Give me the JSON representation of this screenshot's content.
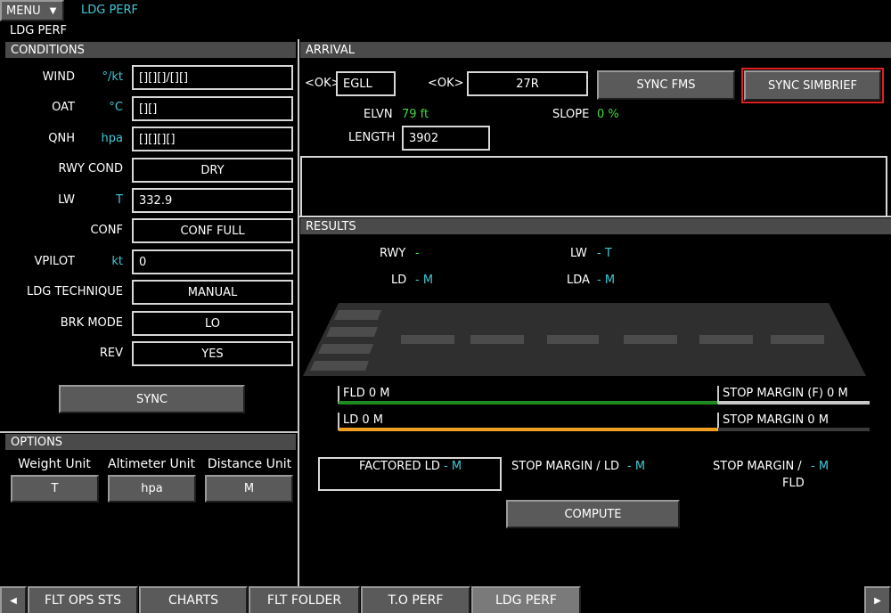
{
  "topbar": {
    "menu": "MENU",
    "title": "LDG PERF",
    "subtitle": "LDG PERF"
  },
  "conditions": {
    "header": "CONDITIONS",
    "rows": [
      {
        "label": "WIND",
        "unit": "°/kt",
        "value": "[][][]/[][]"
      },
      {
        "label": "OAT",
        "unit": "°C",
        "value": "[][]"
      },
      {
        "label": "QNH",
        "unit": "hpa",
        "value": "[][][][]"
      },
      {
        "label": "RWY COND",
        "unit": "",
        "value": "DRY"
      },
      {
        "label": "LW",
        "unit": "T",
        "value": "332.9"
      },
      {
        "label": "CONF",
        "unit": "",
        "value": "CONF FULL"
      },
      {
        "label": "VPILOT",
        "unit": "kt",
        "value": "0"
      },
      {
        "label": "LDG TECHNIQUE",
        "unit": "",
        "value": "MANUAL"
      },
      {
        "label": "BRK MODE",
        "unit": "",
        "value": "LO"
      },
      {
        "label": "REV",
        "unit": "",
        "value": "YES"
      }
    ],
    "sync": "SYNC"
  },
  "options": {
    "header": "OPTIONS",
    "weight_label": "Weight Unit",
    "weight_value": "T",
    "altimeter_label": "Altimeter Unit",
    "altimeter_value": "hpa",
    "distance_label": "Distance Unit",
    "distance_value": "M"
  },
  "arrival": {
    "header": "ARRIVAL",
    "ok1": "<OK>",
    "airport": "EGLL",
    "ok2": "<OK>",
    "runway": "27R",
    "sync_fms": "SYNC FMS",
    "sync_simbrief": "SYNC SIMBRIEF",
    "elvn_label": "ELVN",
    "elvn_value": "79 ft",
    "slope_label": "SLOPE",
    "slope_value": "0 %",
    "length_label": "LENGTH",
    "length_value": "3902"
  },
  "results": {
    "header": "RESULTS",
    "rwy_label": "RWY",
    "rwy_value": "-",
    "lw_label": "LW",
    "lw_value": "- T",
    "ld_label": "LD",
    "ld_value": "- M",
    "lda_label": "LDA",
    "lda_value": "- M",
    "fld_text": "FLD 0 M",
    "stop_margin_f_text": "STOP MARGIN (F) 0 M",
    "ld_text": "LD 0 M",
    "stop_margin_text": "STOP MARGIN 0 M",
    "factored_ld_label": "FACTORED LD",
    "factored_ld_value": "- M",
    "stop_margin_ld_label": "STOP MARGIN / LD",
    "stop_margin_ld_value": "- M",
    "stop_margin_fld_label": "STOP MARGIN /",
    "stop_margin_fld_label2": "FLD",
    "stop_margin_fld_value": "- M",
    "compute": "COMPUTE"
  },
  "tabs": [
    "FLT OPS STS",
    "CHARTS",
    "FLT FOLDER",
    "T.O PERF",
    "LDG PERF"
  ],
  "active_tab": "LDG PERF",
  "colors": {
    "accent": "#3fc8d6",
    "green": "#3ddc3d",
    "fld_bar": "#1e8c1e",
    "ld_bar": "#f0a020",
    "highlight": "#e02020"
  }
}
